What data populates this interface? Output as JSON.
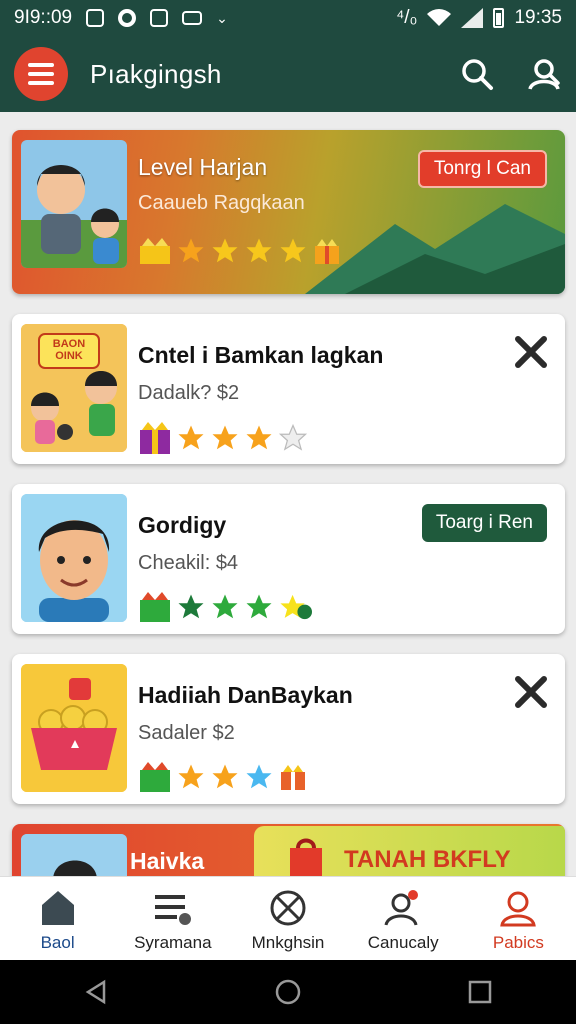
{
  "status_bar": {
    "time_left": "9I9::09",
    "time_right": "19:35",
    "signal_text": "⁴/₀"
  },
  "app_bar": {
    "title": "Pıakgingsh",
    "icons": [
      "menu-icon",
      "search-icon",
      "profile-search-icon"
    ]
  },
  "cards": [
    {
      "title": "Level Harjan",
      "subtitle": "Caaueb Ragqkaan",
      "action": "Tonrg l Can",
      "rating_items": [
        "gift",
        "star",
        "star",
        "star",
        "star",
        "gift"
      ]
    },
    {
      "title": "Cntel i Bamkan lagkan",
      "subtitle": "Dadalk? $2",
      "action_icon": "close-icon",
      "rating_items": [
        "gift",
        "star",
        "star",
        "star",
        "star-empty"
      ]
    },
    {
      "title": "Gordigy",
      "subtitle": "Cheakil: $4",
      "action": "Toarg i Ren",
      "rating_items": [
        "gift",
        "star",
        "star",
        "star",
        "star"
      ]
    },
    {
      "title": "Hadiiah DanBaykan",
      "subtitle": "Sadaler $2",
      "action_icon": "close-icon",
      "rating_items": [
        "gift",
        "star",
        "star",
        "star",
        "gift"
      ]
    }
  ],
  "card1_badge": "BAON OINK",
  "promo": {
    "title": "Haivka",
    "banner": "TANAH BKFLY"
  },
  "bottom_nav": [
    {
      "label": "Baol",
      "icon": "home-icon"
    },
    {
      "label": "Syramana",
      "icon": "list-icon"
    },
    {
      "label": "Mnkghsin",
      "icon": "cancel-circle-icon"
    },
    {
      "label": "Canucaly",
      "icon": "user-notification-icon"
    },
    {
      "label": "Pabics",
      "icon": "user-icon",
      "active": true
    }
  ],
  "colors": {
    "primary": "#1f4a3f",
    "accent": "#e0442f",
    "star": "#f7a21c",
    "green_star": "#2eaa3c"
  }
}
